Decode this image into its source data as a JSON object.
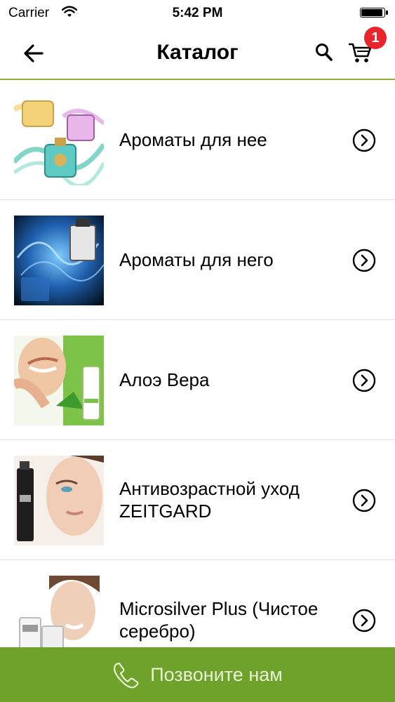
{
  "status_bar": {
    "carrier": "Carrier",
    "time": "5:42 PM"
  },
  "nav": {
    "title": "Каталог",
    "cart_count": "1"
  },
  "catalog": {
    "items": [
      {
        "label": "Ароматы для нее"
      },
      {
        "label": "Ароматы для него"
      },
      {
        "label": "Алоэ Вера"
      },
      {
        "label": "Антивозрастной уход ZEITGARD"
      },
      {
        "label": "Microsilver Plus (Чистое серебро)"
      }
    ]
  },
  "footer": {
    "call_label": "Позвоните нам"
  },
  "colors": {
    "accent_green": "#6ea22a",
    "badge_red": "#e8242c",
    "divider_green": "#8db33a"
  }
}
